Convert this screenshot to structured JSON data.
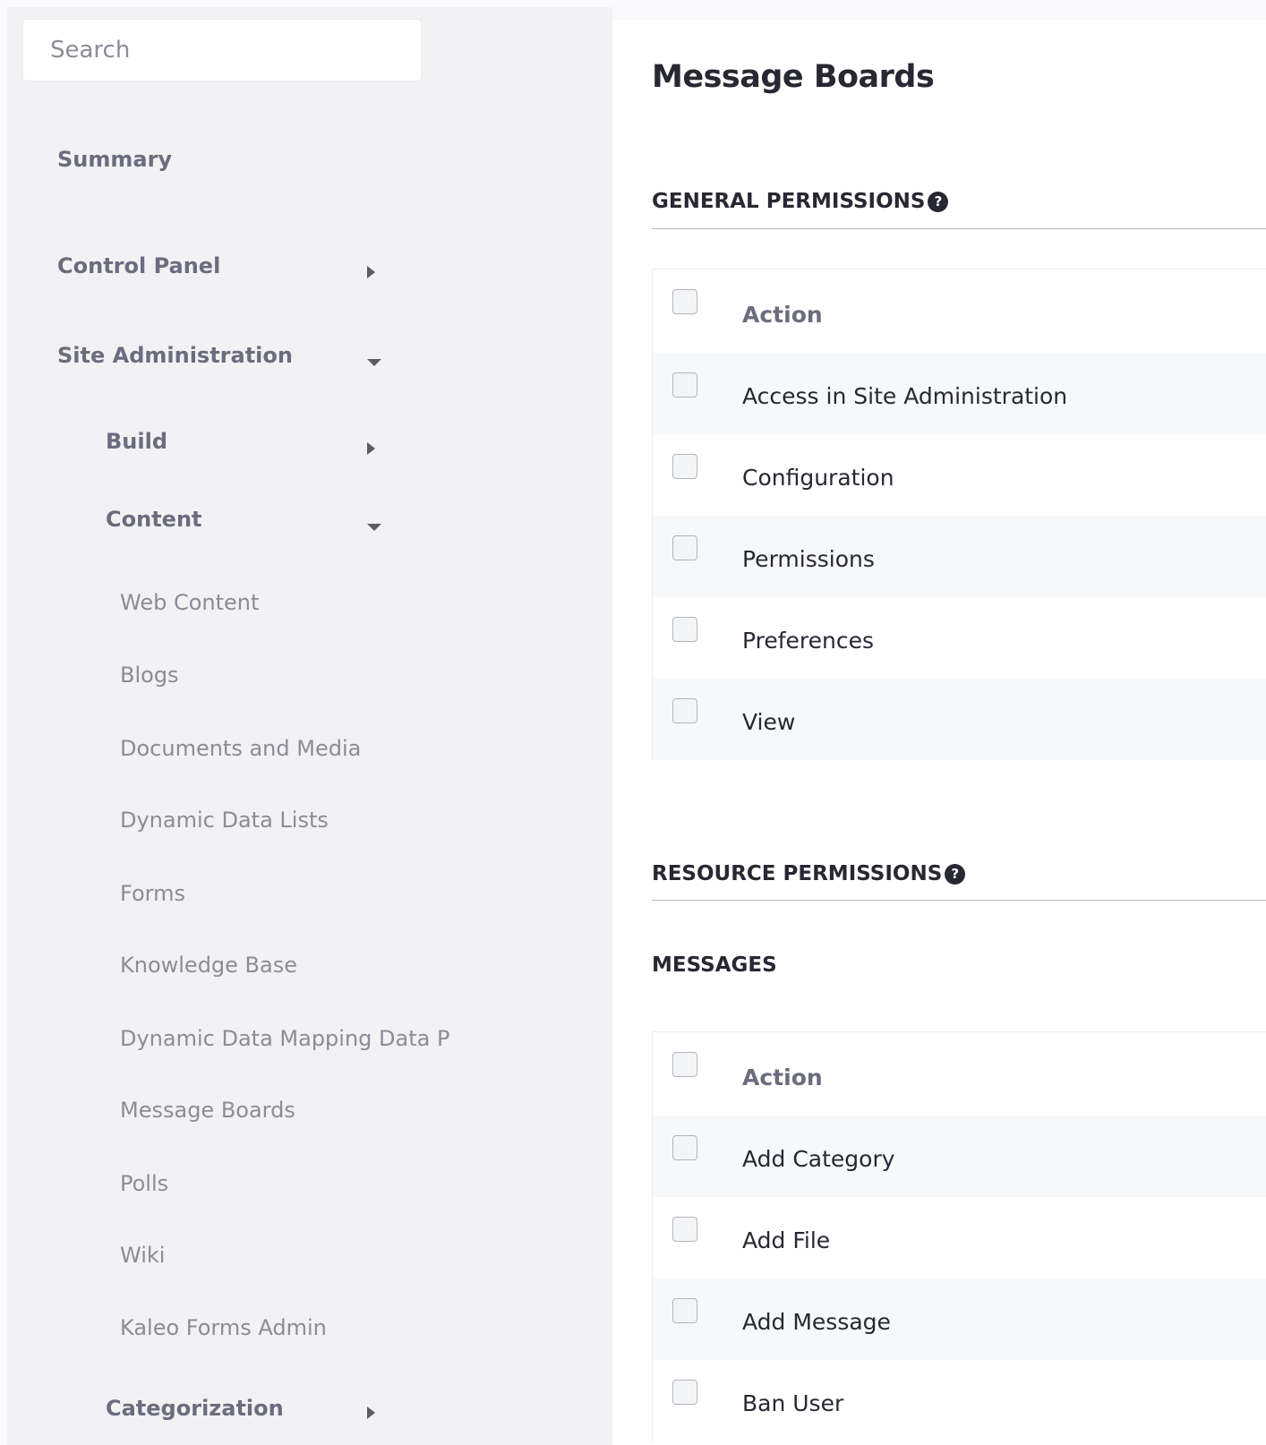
{
  "search": {
    "placeholder": "Search"
  },
  "sidebar": {
    "summary": "Summary",
    "control_panel": "Control Panel",
    "site_administration": "Site Administration",
    "build": "Build",
    "content": "Content",
    "content_items": [
      "Web Content",
      "Blogs",
      "Documents and Media",
      "Dynamic Data Lists",
      "Forms",
      "Knowledge Base",
      "Dynamic Data Mapping Data P",
      "Message Boards",
      "Polls",
      "Wiki",
      "Kaleo Forms Admin"
    ],
    "categorization": "Categorization"
  },
  "main": {
    "title": "Message Boards",
    "general_permissions": {
      "title": "GENERAL PERMISSIONS",
      "help_icon": "?",
      "header": "Action",
      "rows": [
        "Access in Site Administration",
        "Configuration",
        "Permissions",
        "Preferences",
        "View"
      ]
    },
    "resource_permissions": {
      "title": "RESOURCE PERMISSIONS",
      "help_icon": "?",
      "messages": {
        "title": "MESSAGES",
        "header": "Action",
        "rows": [
          "Add Category",
          "Add File",
          "Add Message",
          "Ban User"
        ]
      }
    }
  }
}
